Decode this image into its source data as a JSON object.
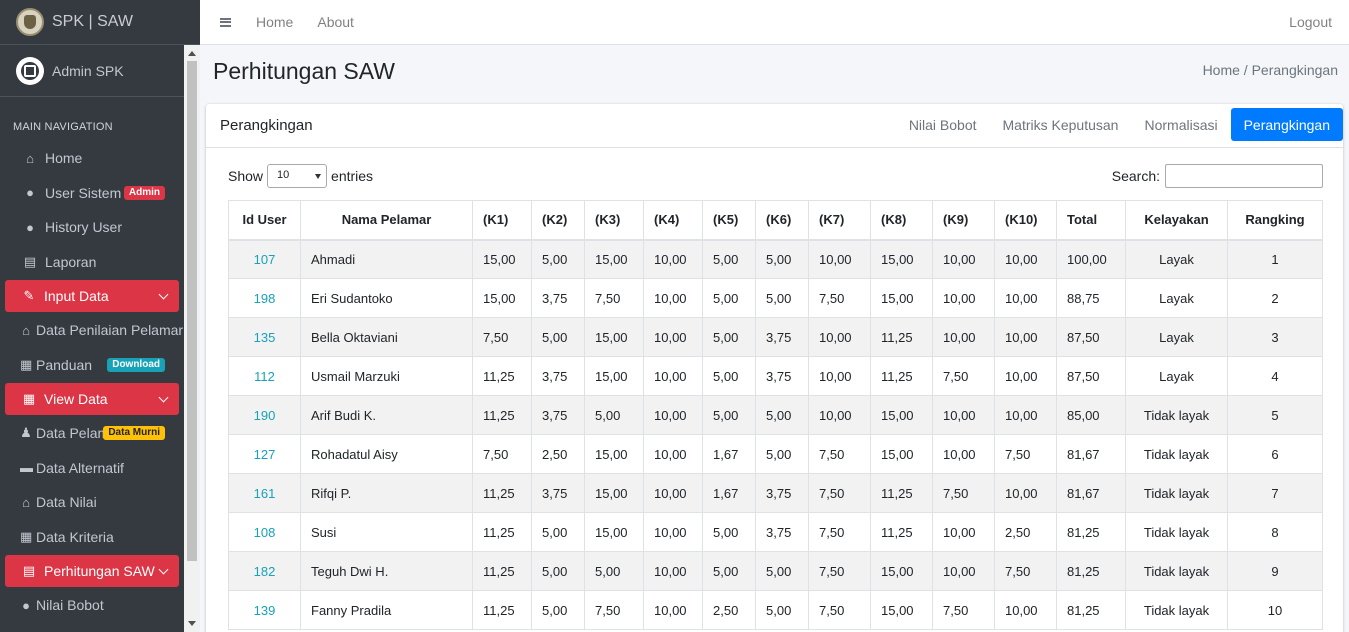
{
  "brand": {
    "title": "SPK | SAW"
  },
  "user": {
    "name": "Admin SPK"
  },
  "sidebar": {
    "header": "MAIN NAVIGATION",
    "items": [
      {
        "label": "Home",
        "icon": "home-icon"
      },
      {
        "label": "User Sistem",
        "icon": "user-icon",
        "badge": "Admin"
      },
      {
        "label": "History User",
        "icon": "users-icon"
      },
      {
        "label": "Laporan",
        "icon": "file-icon"
      },
      {
        "label": "Input Data",
        "icon": "edit-icon"
      },
      {
        "label": "Data Penilaian Pelamar",
        "icon": "institution-icon"
      },
      {
        "label": "Panduan",
        "icon": "table-icon",
        "badge": "Download"
      },
      {
        "label": "View Data",
        "icon": "grid-icon"
      },
      {
        "label": "Data Pelamar",
        "icon": "person-icon",
        "badge": "Data Murni"
      },
      {
        "label": "Data Alternatif",
        "icon": "archive-icon"
      },
      {
        "label": "Data Nilai",
        "icon": "institution-icon"
      },
      {
        "label": "Data Kriteria",
        "icon": "table-icon"
      },
      {
        "label": "Perhitungan SAW",
        "icon": "calculator-icon"
      },
      {
        "label": "Nilai Bobot",
        "icon": "user-icon"
      }
    ]
  },
  "topbar": {
    "home": "Home",
    "about": "About",
    "logout": "Logout"
  },
  "page": {
    "title": "Perhitungan SAW",
    "breadcrumb_home": "Home",
    "breadcrumb_sep": " / ",
    "breadcrumb_current": "Perangkingan"
  },
  "card": {
    "title": "Perangkingan",
    "tabs": [
      "Nilai Bobot",
      "Matriks Keputusan",
      "Normalisasi",
      "Perangkingan"
    ]
  },
  "datatable": {
    "show": "Show",
    "length": "10",
    "entries": "entries",
    "search_label": "Search:",
    "columns": [
      "Id User",
      "Nama Pelamar",
      "(K1)",
      "(K2)",
      "(K3)",
      "(K4)",
      "(K5)",
      "(K6)",
      "(K7)",
      "(K8)",
      "(K9)",
      "(K10)",
      "Total",
      "Kelayakan",
      "Rangking"
    ],
    "rows": [
      [
        "107",
        "Ahmadi",
        "15,00",
        "5,00",
        "15,00",
        "10,00",
        "5,00",
        "5,00",
        "10,00",
        "15,00",
        "10,00",
        "10,00",
        "100,00",
        "Layak",
        "1"
      ],
      [
        "198",
        "Eri Sudantoko",
        "15,00",
        "3,75",
        "7,50",
        "10,00",
        "5,00",
        "5,00",
        "7,50",
        "15,00",
        "10,00",
        "10,00",
        "88,75",
        "Layak",
        "2"
      ],
      [
        "135",
        "Bella Oktaviani",
        "7,50",
        "5,00",
        "15,00",
        "10,00",
        "5,00",
        "3,75",
        "10,00",
        "11,25",
        "10,00",
        "10,00",
        "87,50",
        "Layak",
        "3"
      ],
      [
        "112",
        "Usmail Marzuki",
        "11,25",
        "3,75",
        "15,00",
        "10,00",
        "5,00",
        "3,75",
        "10,00",
        "11,25",
        "7,50",
        "10,00",
        "87,50",
        "Layak",
        "4"
      ],
      [
        "190",
        "Arif Budi K.",
        "11,25",
        "3,75",
        "5,00",
        "10,00",
        "5,00",
        "5,00",
        "10,00",
        "15,00",
        "10,00",
        "10,00",
        "85,00",
        "Tidak layak",
        "5"
      ],
      [
        "127",
        "Rohadatul Aisy",
        "7,50",
        "2,50",
        "15,00",
        "10,00",
        "1,67",
        "5,00",
        "7,50",
        "15,00",
        "10,00",
        "7,50",
        "81,67",
        "Tidak layak",
        "6"
      ],
      [
        "161",
        "Rifqi P.",
        "11,25",
        "3,75",
        "15,00",
        "10,00",
        "1,67",
        "3,75",
        "7,50",
        "11,25",
        "7,50",
        "10,00",
        "81,67",
        "Tidak layak",
        "7"
      ],
      [
        "108",
        "Susi",
        "11,25",
        "5,00",
        "15,00",
        "10,00",
        "5,00",
        "3,75",
        "7,50",
        "11,25",
        "10,00",
        "2,50",
        "81,25",
        "Tidak layak",
        "8"
      ],
      [
        "182",
        "Teguh Dwi H.",
        "11,25",
        "5,00",
        "5,00",
        "10,00",
        "5,00",
        "5,00",
        "7,50",
        "15,00",
        "10,00",
        "7,50",
        "81,25",
        "Tidak layak",
        "9"
      ],
      [
        "139",
        "Fanny Pradila",
        "11,25",
        "5,00",
        "7,50",
        "10,00",
        "2,50",
        "5,00",
        "7,50",
        "15,00",
        "7,50",
        "10,00",
        "81,25",
        "Tidak layak",
        "10"
      ]
    ]
  }
}
